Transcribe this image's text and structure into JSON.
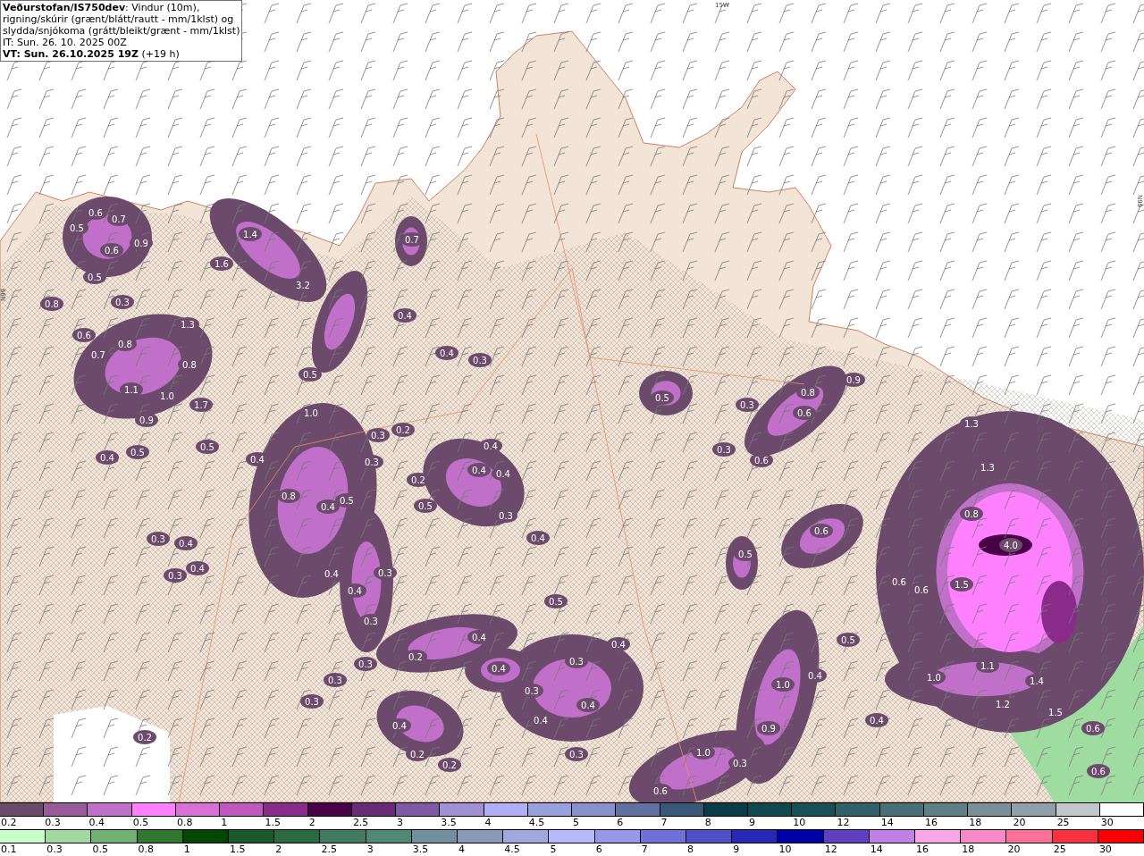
{
  "header": {
    "lines": [
      "**Veðurstofan/IS750dev**: Vindur (10m),",
      "rigning/skúrir (grænt/blátt/rautt - mm/1klst) og",
      "slydda/snjókoma (grátt/bleikt/grænt - mm/1klst)",
      "IT: Sun. 26. 10. 2025 00Z",
      "**VT: Sun. 26.10.2025 19Z** (+19 h)"
    ]
  },
  "map": {
    "grid_labels": [
      "15W",
      "N99",
      "N99"
    ],
    "labels": [
      "0.6",
      "0.7",
      "0.5",
      "1.4",
      "0.9",
      "0.7",
      "0.6",
      "1.6",
      "0.5",
      "3.2",
      "0.8",
      "0.3",
      "0.4",
      "1.3",
      "0.6",
      "0.8",
      "0.7",
      "0.4",
      "0.8",
      "0.3",
      "0.5",
      "0.9",
      "1.1",
      "1.0",
      "0.5",
      "0.8",
      "1.7",
      "0.3",
      "1.0",
      "0.6",
      "0.9",
      "1.3",
      "0.2",
      "0.3",
      "0.4",
      "0.5",
      "0.5",
      "0.4",
      "0.3",
      "0.4",
      "0.3",
      "0.6",
      "0.4",
      "0.4",
      "1.3",
      "0.2",
      "0.8",
      "0.5",
      "0.4",
      "0.5",
      "0.3",
      "0.8",
      "0.6",
      "0.3",
      "0.4",
      "0.4",
      "4.0",
      "0.5",
      "0.3",
      "0.4",
      "0.4",
      "0.3",
      "0.6",
      "1.5",
      "0.4",
      "0.6",
      "0.5",
      "0.3",
      "0.4",
      "0.4",
      "0.5",
      "0.2",
      "0.3",
      "0.3",
      "0.4",
      "1.1",
      "0.3",
      "1.0",
      "0.4",
      "1.0",
      "1.4",
      "0.3",
      "0.3",
      "0.4",
      "1.2",
      "1.5",
      "0.4",
      "0.4",
      "0.4",
      "0.9",
      "0.6",
      "0.2",
      "0.2",
      "0.3",
      "1.0",
      "0.2",
      "0.3",
      "0.6",
      "0.6"
    ]
  },
  "legend": {
    "upper_scale": [
      {
        "label": "0.2",
        "color": "#6b4a6b"
      },
      {
        "label": "0.3",
        "color": "#9a5a9a"
      },
      {
        "label": "0.4",
        "color": "#c070c8"
      },
      {
        "label": "0.5",
        "color": "#ff80ff"
      },
      {
        "label": "0.8",
        "color": "#d870d8"
      },
      {
        "label": "1",
        "color": "#c058c0"
      },
      {
        "label": "1.5",
        "color": "#8a2a8a"
      },
      {
        "label": "2",
        "color": "#4a0048"
      },
      {
        "label": "2.5",
        "color": "#6a2a7a"
      },
      {
        "label": "3",
        "color": "#8058a8"
      },
      {
        "label": "3.5",
        "color": "#a090d8"
      },
      {
        "label": "4",
        "color": "#b0b0f8"
      },
      {
        "label": "4.5",
        "color": "#98a0e0"
      },
      {
        "label": "5",
        "color": "#8890d0"
      },
      {
        "label": "6",
        "color": "#6070a0"
      },
      {
        "label": "7",
        "color": "#385878"
      },
      {
        "label": "8",
        "color": "#083c48"
      },
      {
        "label": "9",
        "color": "#104850"
      },
      {
        "label": "10",
        "color": "#185058"
      },
      {
        "label": "12",
        "color": "#306068"
      },
      {
        "label": "14",
        "color": "#487078"
      },
      {
        "label": "16",
        "color": "#608088"
      },
      {
        "label": "18",
        "color": "#7a9098"
      },
      {
        "label": "20",
        "color": "#90a0a8"
      },
      {
        "label": "25",
        "color": "#c0c8cc"
      },
      {
        "label": "30",
        "color": "#ffffff"
      }
    ],
    "lower_scale": [
      {
        "label": "0.1",
        "color": "#c8ffc8"
      },
      {
        "label": "0.3",
        "color": "#a0d8a0"
      },
      {
        "label": "0.5",
        "color": "#70b070"
      },
      {
        "label": "0.8",
        "color": "#307830"
      },
      {
        "label": "1",
        "color": "#004800"
      },
      {
        "label": "1.5",
        "color": "#1a5a2a"
      },
      {
        "label": "2",
        "color": "#2a6a40"
      },
      {
        "label": "2.5",
        "color": "#407a60"
      },
      {
        "label": "3",
        "color": "#508878"
      },
      {
        "label": "3.5",
        "color": "#7090a0"
      },
      {
        "label": "4",
        "color": "#8898b8"
      },
      {
        "label": "4.5",
        "color": "#a0a8e0"
      },
      {
        "label": "5",
        "color": "#b8b8ff"
      },
      {
        "label": "6",
        "color": "#9898e8"
      },
      {
        "label": "7",
        "color": "#7070d8"
      },
      {
        "label": "8",
        "color": "#5050c8"
      },
      {
        "label": "9",
        "color": "#2828b8"
      },
      {
        "label": "10",
        "color": "#0000a8"
      },
      {
        "label": "12",
        "color": "#6040c0"
      },
      {
        "label": "14",
        "color": "#c080e8"
      },
      {
        "label": "16",
        "color": "#f8a8e8"
      },
      {
        "label": "18",
        "color": "#f888c8"
      },
      {
        "label": "20",
        "color": "#f87098"
      },
      {
        "label": "25",
        "color": "#f83040"
      },
      {
        "label": "30",
        "color": "#f80000"
      }
    ]
  }
}
